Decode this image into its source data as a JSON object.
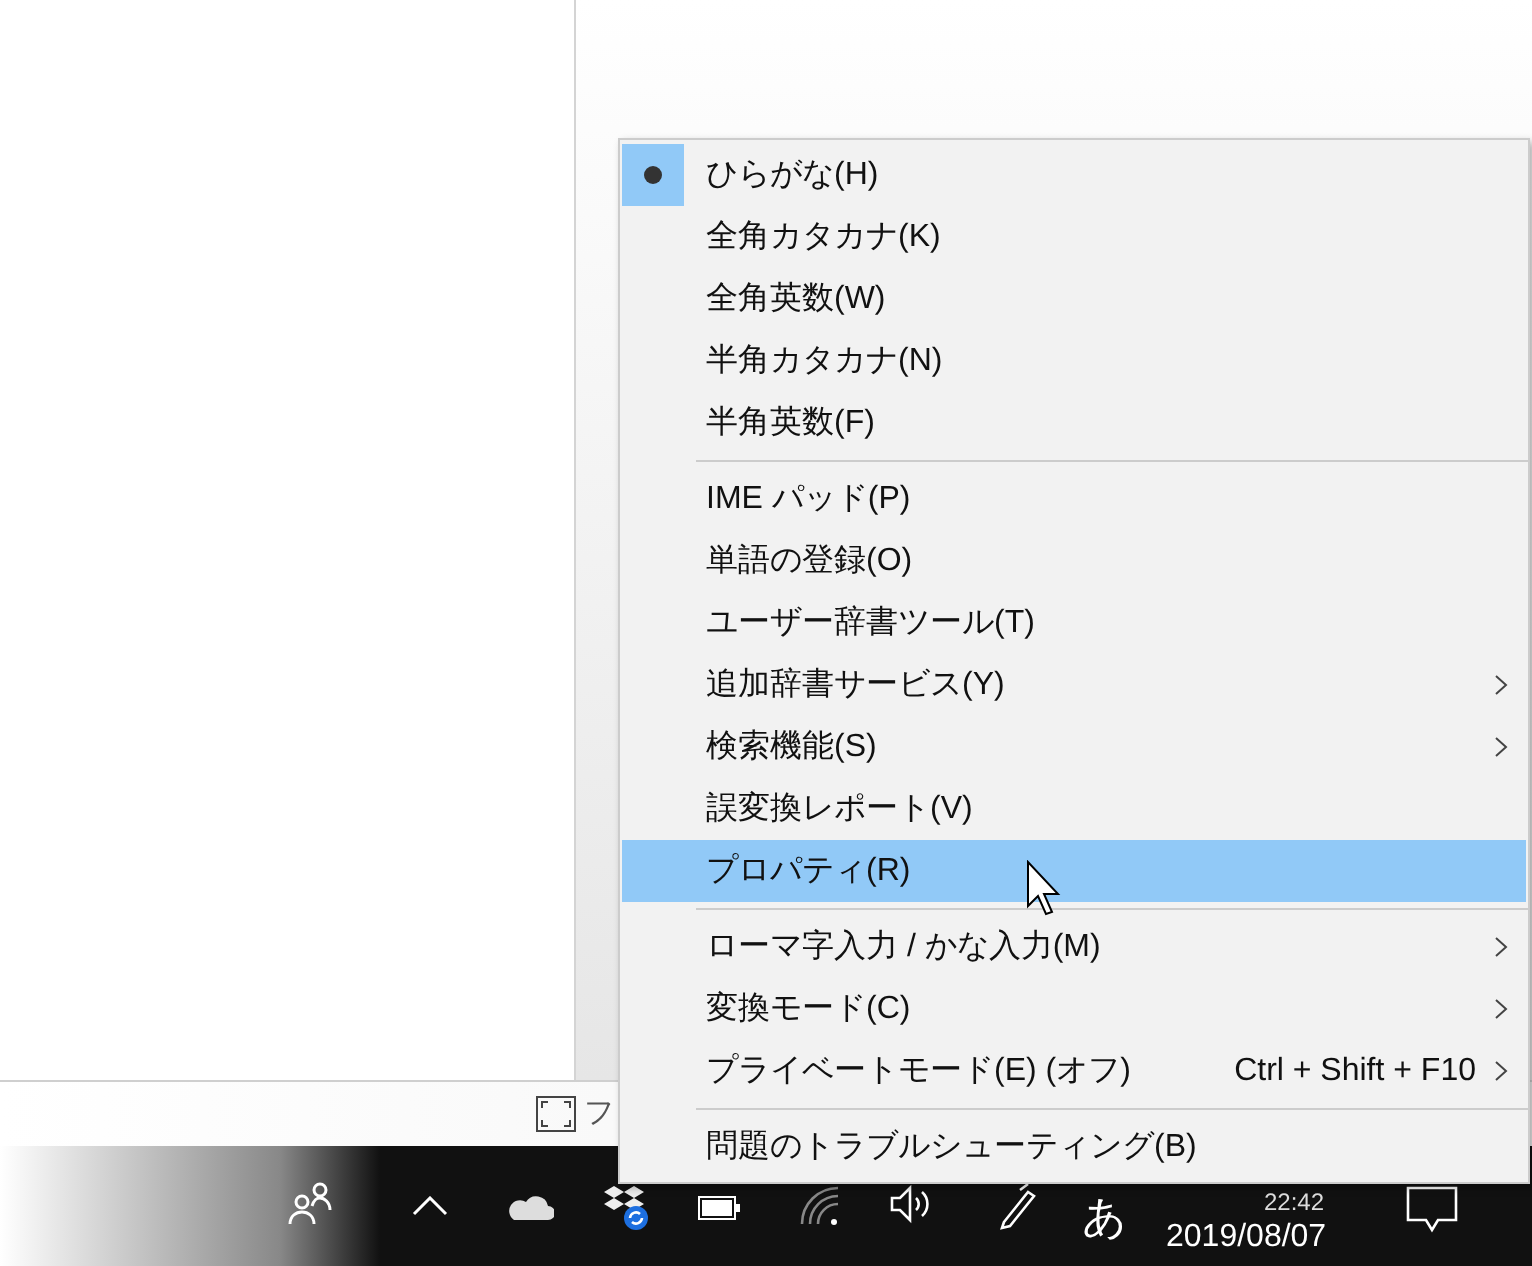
{
  "menu": {
    "sections": [
      {
        "items": [
          {
            "label": "ひらがな(H)",
            "checked": true,
            "selected": false,
            "submenu": false
          },
          {
            "label": "全角カタカナ(K)",
            "checked": false,
            "selected": false,
            "submenu": false
          },
          {
            "label": "全角英数(W)",
            "checked": false,
            "selected": false,
            "submenu": false
          },
          {
            "label": "半角カタカナ(N)",
            "checked": false,
            "selected": false,
            "submenu": false
          },
          {
            "label": "半角英数(F)",
            "checked": false,
            "selected": false,
            "submenu": false
          }
        ]
      },
      {
        "items": [
          {
            "label": "IME パッド(P)",
            "checked": false,
            "selected": false,
            "submenu": false
          },
          {
            "label": "単語の登録(O)",
            "checked": false,
            "selected": false,
            "submenu": false
          },
          {
            "label": "ユーザー辞書ツール(T)",
            "checked": false,
            "selected": false,
            "submenu": false
          },
          {
            "label": "追加辞書サービス(Y)",
            "checked": false,
            "selected": false,
            "submenu": true
          },
          {
            "label": "検索機能(S)",
            "checked": false,
            "selected": false,
            "submenu": true
          },
          {
            "label": "誤変換レポート(V)",
            "checked": false,
            "selected": false,
            "submenu": false
          },
          {
            "label": "プロパティ(R)",
            "checked": false,
            "selected": true,
            "submenu": false
          }
        ]
      },
      {
        "items": [
          {
            "label": "ローマ字入力 / かな入力(M)",
            "checked": false,
            "selected": false,
            "submenu": true
          },
          {
            "label": "変換モード(C)",
            "checked": false,
            "selected": false,
            "submenu": true
          },
          {
            "label": "プライベートモード(E) (オフ)",
            "shortcut": "Ctrl + Shift + F10",
            "checked": false,
            "selected": false,
            "submenu": true
          }
        ]
      },
      {
        "items": [
          {
            "label": "問題のトラブルシューティング(B)",
            "checked": false,
            "selected": false,
            "submenu": false
          }
        ]
      }
    ]
  },
  "status_strip": {
    "text": "フ"
  },
  "taskbar": {
    "ime_mode": "あ",
    "time": "22:42",
    "date": "2019/08/07"
  }
}
